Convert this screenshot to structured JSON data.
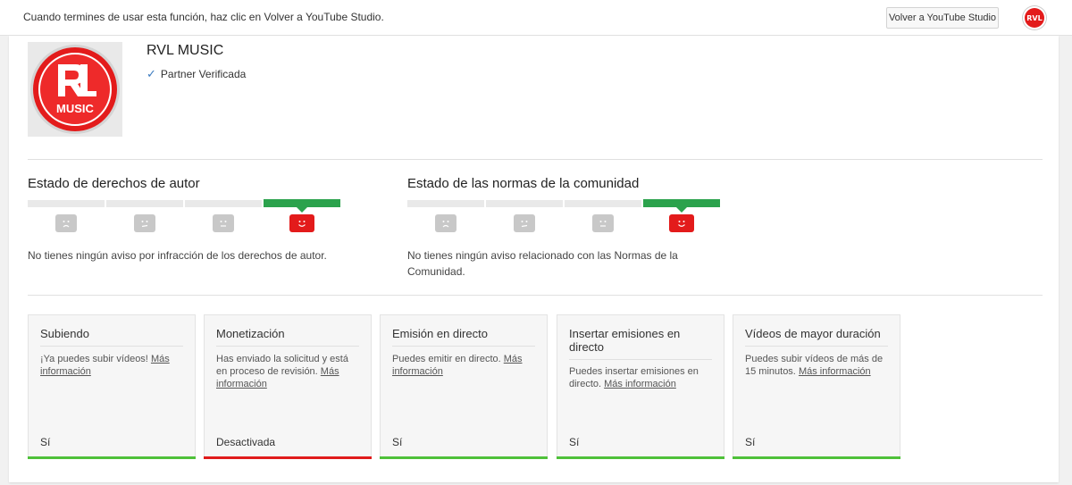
{
  "topbar": {
    "message": "Cuando termines de usar esta función, haz clic en Volver a YouTube Studio.",
    "studio_button": "Volver a YouTube Studio",
    "avatar_icon": "channel-logo-icon"
  },
  "channel": {
    "name": "RVL MUSIC",
    "partner_label": "Partner Verificada",
    "logo_text_top": "RVL",
    "logo_text_bottom": "MUSIC"
  },
  "copyright": {
    "title": "Estado de derechos de autor",
    "status": "No tienes ningún aviso por infracción de los derechos de autor."
  },
  "community": {
    "title": "Estado de las normas de la comunidad",
    "status": "No tienes ningún aviso relacionado con las Normas de la Comunidad."
  },
  "colors": {
    "good": "#2ba24c",
    "bad": "#e31b1b",
    "card_ok": "#4fc13a",
    "card_off": "#e01b1b"
  },
  "features": [
    {
      "title": "Subiendo",
      "desc": "¡Ya puedes subir vídeos!",
      "link": "Más información",
      "status": "Sí"
    },
    {
      "title": "Monetización",
      "desc": "Has enviado la solicitud y está en proceso de revisión.",
      "link": "Más información",
      "status": "Desactivada"
    },
    {
      "title": "Emisión en directo",
      "desc": "Puedes emitir en directo.",
      "link": "Más información",
      "status": "Sí"
    },
    {
      "title": "Insertar emisiones en directo",
      "desc": "Puedes insertar emisiones en directo.",
      "link": "Más información",
      "status": "Sí"
    },
    {
      "title": "Vídeos de mayor duración",
      "desc": "Puedes subir vídeos de más de 15 minutos.",
      "link": "Más información",
      "status": "Sí"
    }
  ]
}
